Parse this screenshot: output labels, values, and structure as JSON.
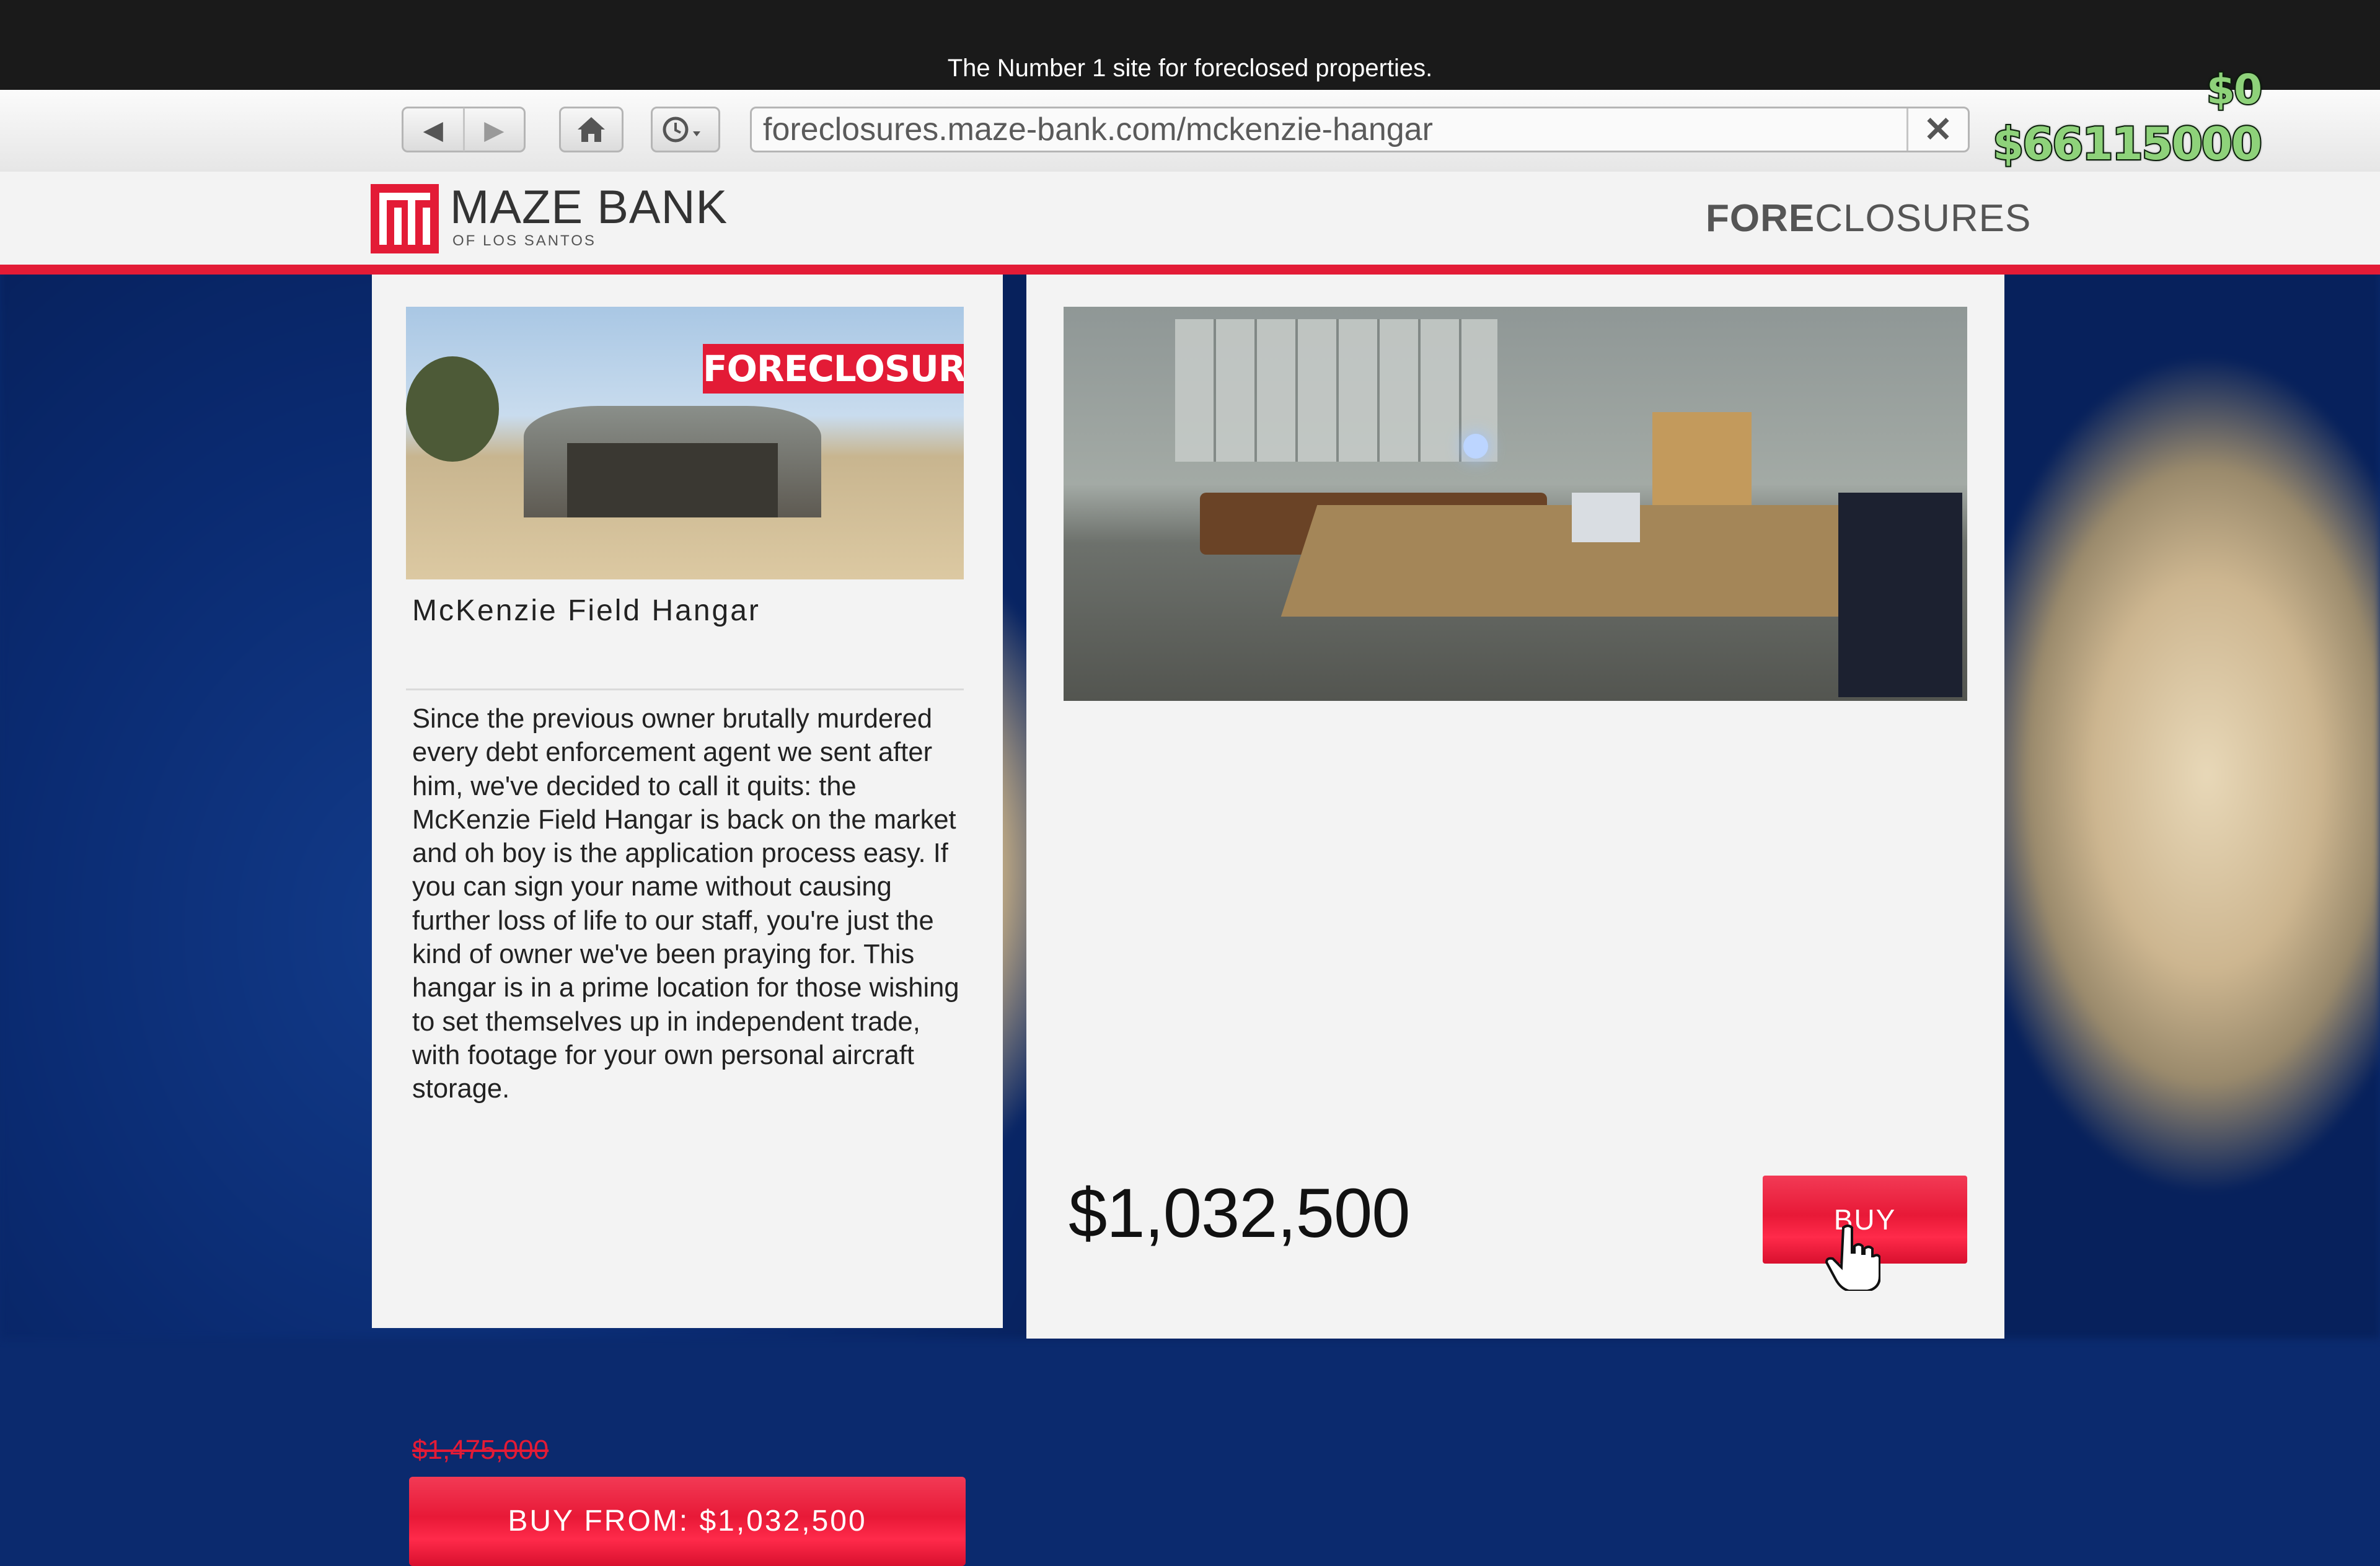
{
  "top_bar": {
    "tagline": "The Number 1 site for foreclosed properties."
  },
  "browser": {
    "back_icon": "◀",
    "forward_icon": "▶",
    "home_icon": "home-icon",
    "history_icon": "history-icon",
    "url": "foreclosures.maze-bank.com/mckenzie-hangar",
    "close_label": "✕"
  },
  "hud": {
    "cash_change": "$0",
    "bank_balance": "$66115000"
  },
  "site": {
    "logo_name": "MAZE BANK",
    "logo_sub": "OF LOS SANTOS",
    "section_bold": "FORE",
    "section_rest": "CLOSURES",
    "brand_color": "#e31b36"
  },
  "property": {
    "banner": "FORECLOSURE",
    "name": "McKenzie Field Hangar",
    "description": "Since the previous owner brutally murdered every debt enforcement agent we sent after him, we've decided to call it quits: the McKenzie Field Hangar is back on the market and oh boy is the application process easy. If you can sign your name without causing further loss of life to our staff, you're just the kind of owner we've been praying for. This hangar is in a prime location for those wishing to set themselves up in independent trade, with footage for your own personal aircraft storage.",
    "original_price": "$1,475,000",
    "buy_from_label": "BUY FROM: $1,032,500",
    "price": "$1,032,500",
    "buy_label": "BUY"
  }
}
